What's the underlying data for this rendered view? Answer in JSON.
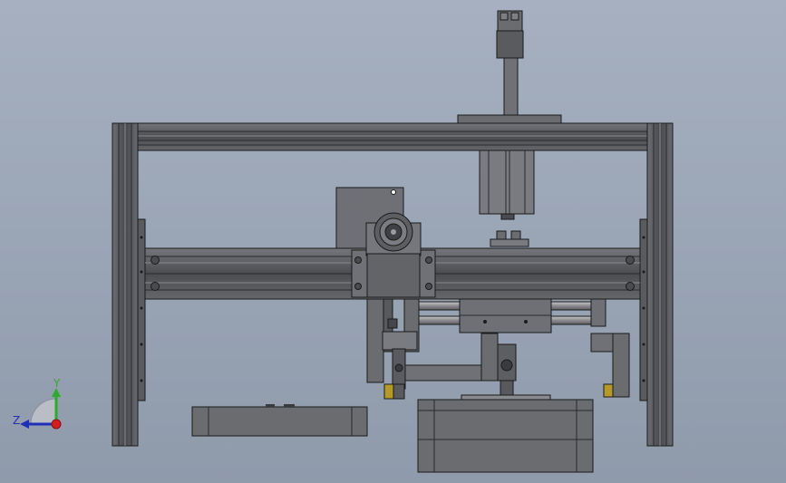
{
  "app": {
    "view": "cad-3d-viewport"
  },
  "triad": {
    "y_label": "Y",
    "z_label": "Z",
    "colors": {
      "y": "#2eaa2e",
      "z": "#1f2fb8",
      "x": "#d21e1e"
    }
  },
  "colors": {
    "background_top": "#a6b0c0",
    "background_bottom": "#8f9aab",
    "frame": "#5f6064",
    "frame_dark": "#3d3e42",
    "frame_light": "#7a7b80",
    "part_mid": "#6b6c70",
    "accent_yellow": "#b59a2a"
  }
}
